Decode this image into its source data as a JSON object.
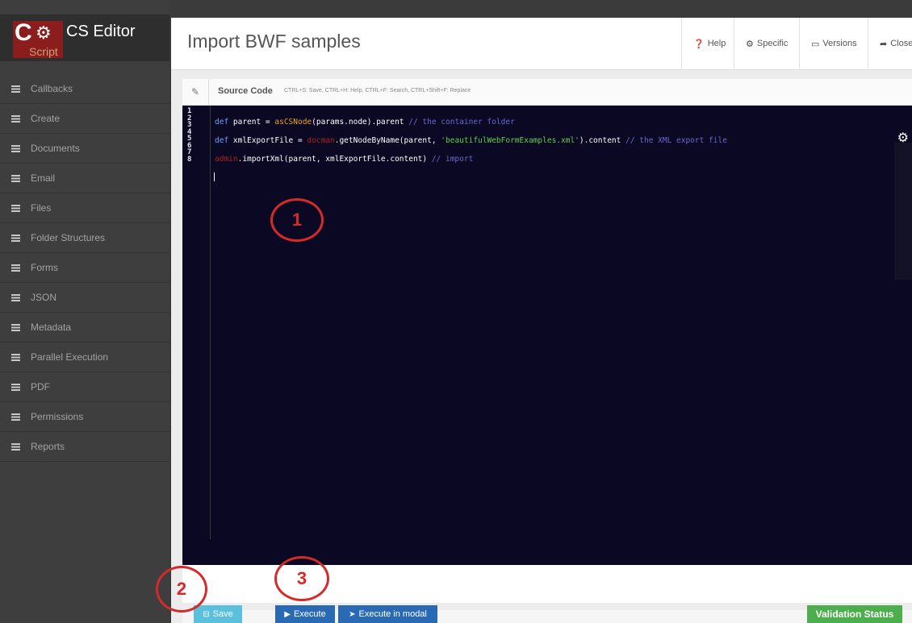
{
  "app": {
    "logo_letter": "C",
    "logo_sub": "Script",
    "title": "CS Editor"
  },
  "sidebar": {
    "items": [
      {
        "label": "Callbacks"
      },
      {
        "label": "Create"
      },
      {
        "label": "Documents"
      },
      {
        "label": "Email"
      },
      {
        "label": "Files"
      },
      {
        "label": "Folder Structures"
      },
      {
        "label": "Forms"
      },
      {
        "label": "JSON"
      },
      {
        "label": "Metadata"
      },
      {
        "label": "Parallel Execution"
      },
      {
        "label": "PDF"
      },
      {
        "label": "Permissions"
      },
      {
        "label": "Reports"
      }
    ]
  },
  "header": {
    "title": "Import BWF samples",
    "help": "Help",
    "specific": "Specific",
    "versions": "Versions",
    "close": "Close"
  },
  "editor": {
    "section_title": "Source Code",
    "shortcuts": "CTRL+S: Save, CTRL+H: Help, CTRL+F: Search, CTRL+Shift+F: Replace",
    "line_numbers": [
      "1",
      "2",
      "3",
      "4",
      "5",
      "6",
      "7",
      "8"
    ],
    "code_lines": [
      "def parent = asCSNode(params.node).parent // the container folder",
      "def xmlExportFile = docman.getNodeByName(parent, 'beautifulWebFormExamples.xml').content // the XML export file",
      "admin.importXml(parent, xmlExportFile.content) // import"
    ]
  },
  "footer": {
    "save": "Save",
    "execute": "Execute",
    "execute_modal": "Execute in modal",
    "validation": "Validation Status"
  },
  "annotations": [
    "1",
    "2",
    "3"
  ]
}
